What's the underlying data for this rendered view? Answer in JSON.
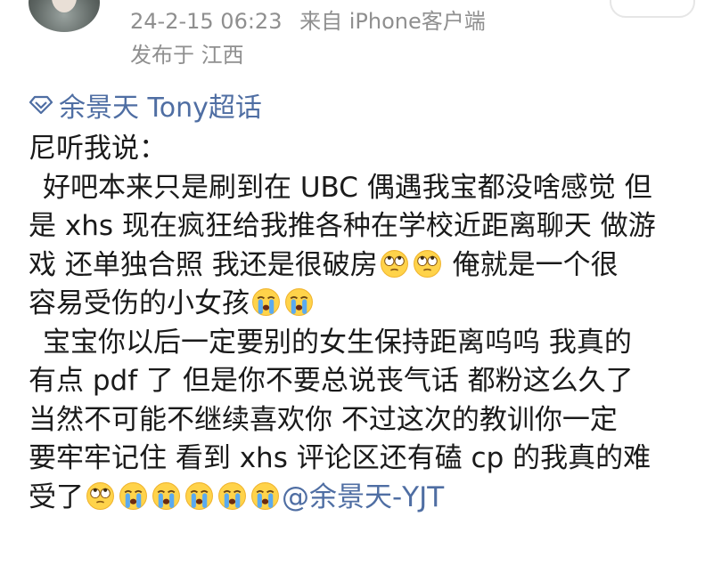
{
  "header": {
    "time": "24-2-15 06:23",
    "source": "来自 iPhone客户端",
    "location": "发布于 江西"
  },
  "topic": {
    "label": "余景天 Tony超话",
    "icon": "supertopic-diamond-icon",
    "color": "#4f6ea3"
  },
  "post": {
    "lines": [
      "尼听我说：",
      "好吧本来只是刷到在 UBC 偶遇我宝都没啥感觉 但",
      "是 xhs 现在疯狂给我推各种在学校近距离聊天 做游",
      "戏 还单独合照 我还是很破房",
      "俺就是一个很",
      "容易受伤的小女孩",
      "宝宝你以后一定要别的女生保持距离呜呜 我真的",
      "有点 pdf 了 但是你不要总说丧气话 都粉这么久了",
      "当然不可能不继续喜欢你 不过这次的教训你一定",
      "要牢牢记住 看到 xhs 评论区还有磕 cp 的我真的难",
      "受了"
    ],
    "mention": "@余景天-YJT",
    "emojis": [
      "eye-roll-emoji",
      "crying-emoji"
    ]
  },
  "colors": {
    "meta": "#8f8f8f",
    "link": "#4f6ea3",
    "text": "#1a1a1a"
  }
}
